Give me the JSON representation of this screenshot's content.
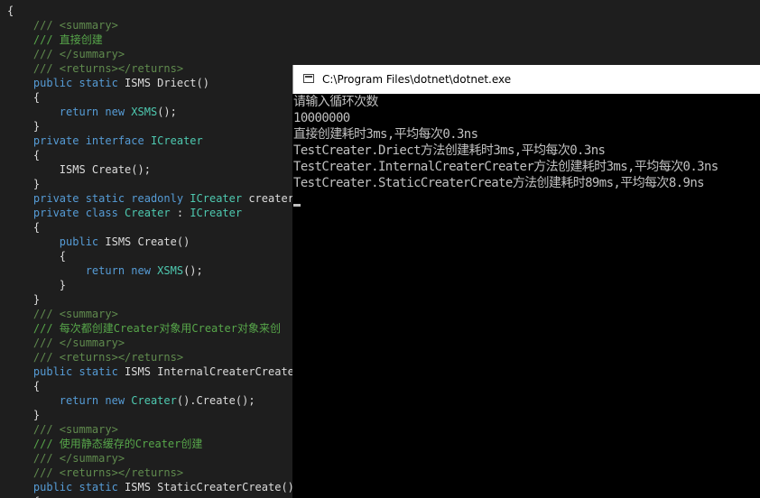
{
  "editor": {
    "lines": [
      {
        "segments": [
          {
            "c": "tok-plain",
            "t": "{"
          }
        ]
      },
      {
        "segments": [
          {
            "c": "tok-doctag",
            "t": "    /// "
          },
          {
            "c": "tok-doctag",
            "t": "<summary>"
          }
        ]
      },
      {
        "segments": [
          {
            "c": "tok-comment",
            "t": "    /// 直接创建"
          }
        ]
      },
      {
        "segments": [
          {
            "c": "tok-doctag",
            "t": "    /// "
          },
          {
            "c": "tok-doctag",
            "t": "</summary>"
          }
        ]
      },
      {
        "segments": [
          {
            "c": "tok-doctag",
            "t": "    /// "
          },
          {
            "c": "tok-doctag",
            "t": "<returns></returns>"
          }
        ]
      },
      {
        "segments": [
          {
            "c": "tok-keyword",
            "t": "    public static "
          },
          {
            "c": "tok-plain",
            "t": "ISMS Driect()"
          }
        ]
      },
      {
        "segments": [
          {
            "c": "tok-plain",
            "t": "    {"
          }
        ]
      },
      {
        "segments": [
          {
            "c": "tok-keyword",
            "t": "        return new "
          },
          {
            "c": "tok-type",
            "t": "XSMS"
          },
          {
            "c": "tok-plain",
            "t": "();"
          }
        ]
      },
      {
        "segments": [
          {
            "c": "tok-plain",
            "t": "    }"
          }
        ]
      },
      {
        "segments": [
          {
            "c": "tok-keyword",
            "t": "    private interface "
          },
          {
            "c": "tok-type",
            "t": "ICreater"
          }
        ]
      },
      {
        "segments": [
          {
            "c": "tok-plain",
            "t": "    {"
          }
        ]
      },
      {
        "segments": [
          {
            "c": "tok-plain",
            "t": "        ISMS Create();"
          }
        ]
      },
      {
        "segments": [
          {
            "c": "tok-plain",
            "t": "    }"
          }
        ]
      },
      {
        "segments": [
          {
            "c": "tok-keyword",
            "t": "    private static readonly "
          },
          {
            "c": "tok-type",
            "t": "ICreater"
          },
          {
            "c": "tok-plain",
            "t": " creater ="
          }
        ]
      },
      {
        "segments": [
          {
            "c": "tok-keyword",
            "t": "    private class "
          },
          {
            "c": "tok-type",
            "t": "Creater"
          },
          {
            "c": "tok-plain",
            "t": " : "
          },
          {
            "c": "tok-type",
            "t": "ICreater"
          }
        ]
      },
      {
        "segments": [
          {
            "c": "tok-plain",
            "t": "    {"
          }
        ]
      },
      {
        "segments": [
          {
            "c": "tok-keyword",
            "t": "        public "
          },
          {
            "c": "tok-plain",
            "t": "ISMS Create()"
          }
        ]
      },
      {
        "segments": [
          {
            "c": "tok-plain",
            "t": "        {"
          }
        ]
      },
      {
        "segments": [
          {
            "c": "tok-keyword",
            "t": "            return new "
          },
          {
            "c": "tok-type",
            "t": "XSMS"
          },
          {
            "c": "tok-plain",
            "t": "();"
          }
        ]
      },
      {
        "segments": [
          {
            "c": "tok-plain",
            "t": "        }"
          }
        ]
      },
      {
        "segments": [
          {
            "c": "tok-plain",
            "t": "    }"
          }
        ]
      },
      {
        "segments": [
          {
            "c": "tok-doctag",
            "t": "    /// "
          },
          {
            "c": "tok-doctag",
            "t": "<summary>"
          }
        ]
      },
      {
        "segments": [
          {
            "c": "tok-comment",
            "t": "    /// 每次都创建Creater对象用Creater对象来创"
          }
        ]
      },
      {
        "segments": [
          {
            "c": "tok-doctag",
            "t": "    /// "
          },
          {
            "c": "tok-doctag",
            "t": "</summary>"
          }
        ]
      },
      {
        "segments": [
          {
            "c": "tok-doctag",
            "t": "    /// "
          },
          {
            "c": "tok-doctag",
            "t": "<returns></returns>"
          }
        ]
      },
      {
        "segments": [
          {
            "c": "tok-keyword",
            "t": "    public static "
          },
          {
            "c": "tok-plain",
            "t": "ISMS InternalCreaterCreater"
          }
        ]
      },
      {
        "segments": [
          {
            "c": "tok-plain",
            "t": "    {"
          }
        ]
      },
      {
        "segments": [
          {
            "c": "tok-keyword",
            "t": "        return new "
          },
          {
            "c": "tok-type",
            "t": "Creater"
          },
          {
            "c": "tok-plain",
            "t": "().Create();"
          }
        ]
      },
      {
        "segments": [
          {
            "c": "tok-plain",
            "t": "    }"
          }
        ]
      },
      {
        "segments": [
          {
            "c": "tok-doctag",
            "t": "    /// "
          },
          {
            "c": "tok-doctag",
            "t": "<summary>"
          }
        ]
      },
      {
        "segments": [
          {
            "c": "tok-comment",
            "t": "    /// 使用静态缓存的Creater创建"
          }
        ]
      },
      {
        "segments": [
          {
            "c": "tok-doctag",
            "t": "    /// "
          },
          {
            "c": "tok-doctag",
            "t": "</summary>"
          }
        ]
      },
      {
        "segments": [
          {
            "c": "tok-doctag",
            "t": "    /// "
          },
          {
            "c": "tok-doctag",
            "t": "<returns></returns>"
          }
        ]
      },
      {
        "segments": [
          {
            "c": "tok-keyword",
            "t": "    public static "
          },
          {
            "c": "tok-plain",
            "t": "ISMS StaticCreaterCreate()"
          }
        ]
      },
      {
        "segments": [
          {
            "c": "tok-plain",
            "t": "    {"
          }
        ]
      }
    ]
  },
  "console": {
    "title": "C:\\Program Files\\dotnet\\dotnet.exe",
    "output": [
      "请输入循环次数",
      "10000000",
      "直接创建耗时3ms,平均每次0.3ns",
      "TestCreater.Driect方法创建耗时3ms,平均每次0.3ns",
      "TestCreater.InternalCreaterCreater方法创建耗时3ms,平均每次0.3ns",
      "TestCreater.StaticCreaterCreate方法创建耗时89ms,平均每次8.9ns"
    ]
  },
  "colors": {
    "editor_bg": "#1e1e1e",
    "keyword": "#569cd6",
    "type": "#4ec9b0",
    "comment": "#57a64a",
    "console_bg": "#000000",
    "console_text": "#c0c0c0"
  }
}
